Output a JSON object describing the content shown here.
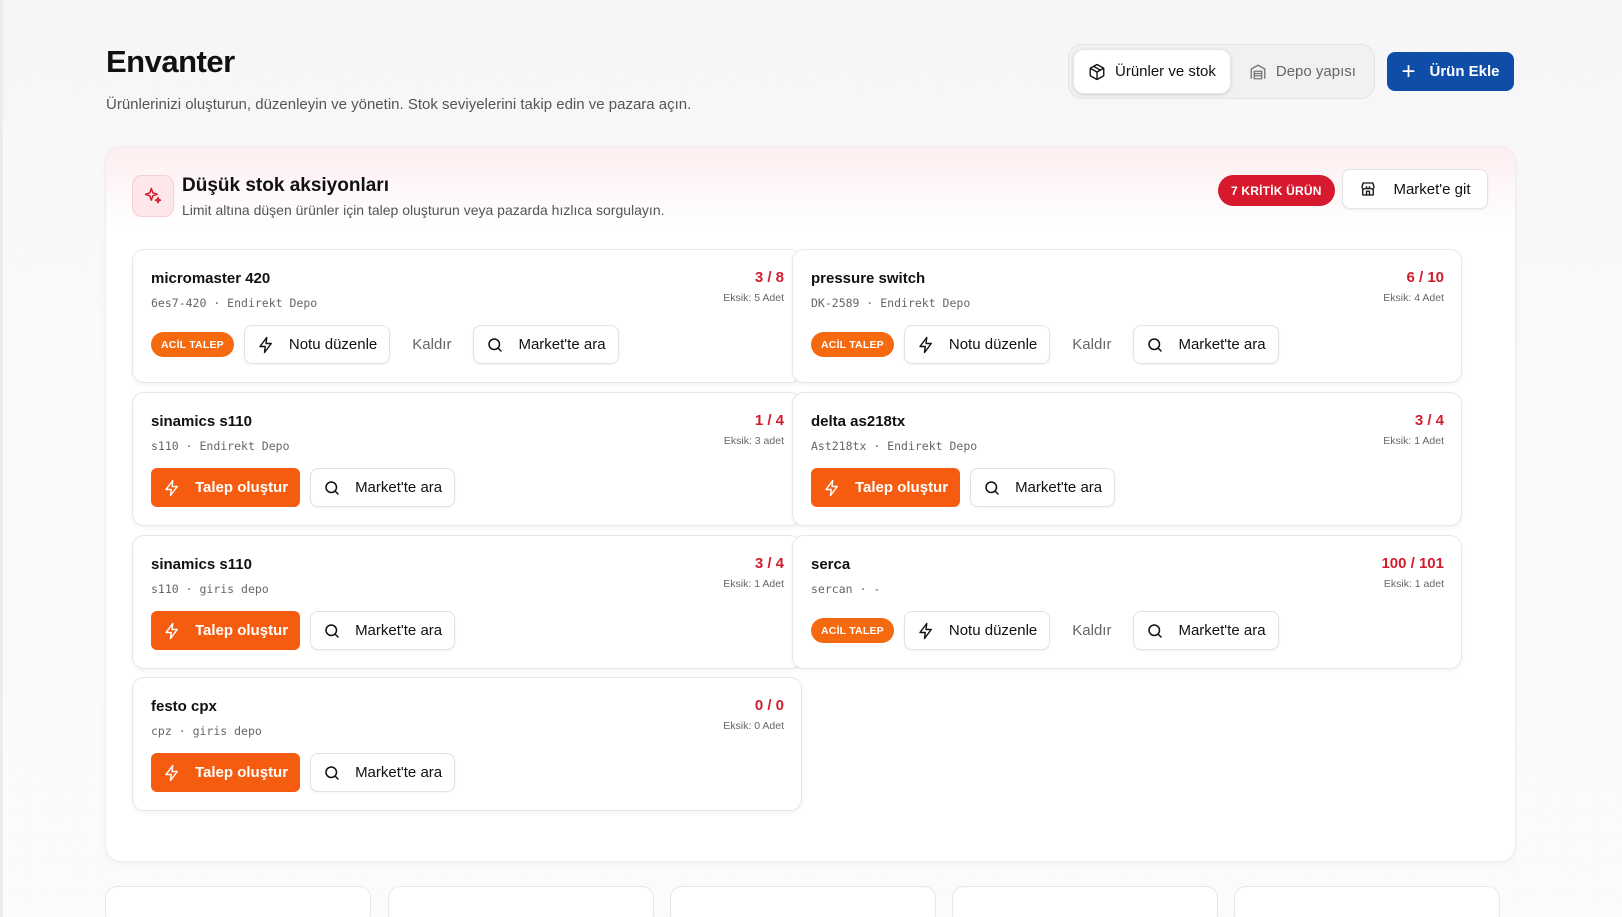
{
  "page": {
    "title": "Envanter",
    "subtitle": "Ürünlerinizi oluşturun, düzenleyin ve yönetin. Stok seviyelerini takip edin ve pazara açın."
  },
  "view_toggle": {
    "products": "Ürünler ve stok",
    "warehouse": "Depo yapısı",
    "active": "products"
  },
  "add_button": "Ürün Ekle",
  "panel": {
    "title": "Düşük stok aksiyonları",
    "subtitle": "Limit altına düşen ürünler için talep oluşturun veya pazarda hızlıca sorgulayın.",
    "critical_badge": "7 KRİTİK ÜRÜN",
    "market_button": "Market'e git"
  },
  "labels": {
    "urgent": "ACİL TALEP",
    "edit_note": "Notu düzenle",
    "remove": "Kaldır",
    "search_market": "Market'te ara",
    "create_request": "Talep oluştur"
  },
  "cards": [
    {
      "name": "micromaster 420",
      "code": "6es7-420",
      "warehouse": "Endirekt Depo",
      "count": "3 / 8",
      "missing": "Eksik: 5 Adet",
      "state": "urgent"
    },
    {
      "name": "pressure switch",
      "code": "DK-2589",
      "warehouse": "Endirekt Depo",
      "count": "6 / 10",
      "missing": "Eksik: 4 Adet",
      "state": "urgent"
    },
    {
      "name": "sinamics s110",
      "code": "s110",
      "warehouse": "Endirekt Depo",
      "count": "1 / 4",
      "missing": "Eksik: 3 adet",
      "state": "request"
    },
    {
      "name": "delta as218tx",
      "code": "Ast218tx",
      "warehouse": "Endirekt Depo",
      "count": "3 / 4",
      "missing": "Eksik: 1 Adet",
      "state": "request"
    },
    {
      "name": "sinamics s110",
      "code": "s110",
      "warehouse": "giris depo",
      "count": "3 / 4",
      "missing": "Eksik: 1 Adet",
      "state": "request"
    },
    {
      "name": "serca",
      "code": "sercan",
      "warehouse": "-",
      "count": "100 / 101",
      "missing": "Eksik: 1 adet",
      "state": "urgent"
    },
    {
      "name": "festo cpx",
      "code": "cpz",
      "warehouse": "giris depo",
      "count": "0 / 0",
      "missing": "Eksik: 0 Adet",
      "state": "request"
    }
  ],
  "colors": {
    "brand_blue": "#0f4ea8",
    "critical_red": "#d7192e",
    "urgent_orange": "#f5690f",
    "request_orange": "#f65c10",
    "count_red": "#d21d2d"
  },
  "icons": {
    "products_tab": "box-icon",
    "warehouse_tab": "warehouse-icon",
    "add": "plus-icon",
    "panel": "sparkle-icon",
    "market": "store-icon",
    "edit_note": "bolt-icon",
    "create_request": "bolt-icon",
    "search": "search-icon"
  }
}
